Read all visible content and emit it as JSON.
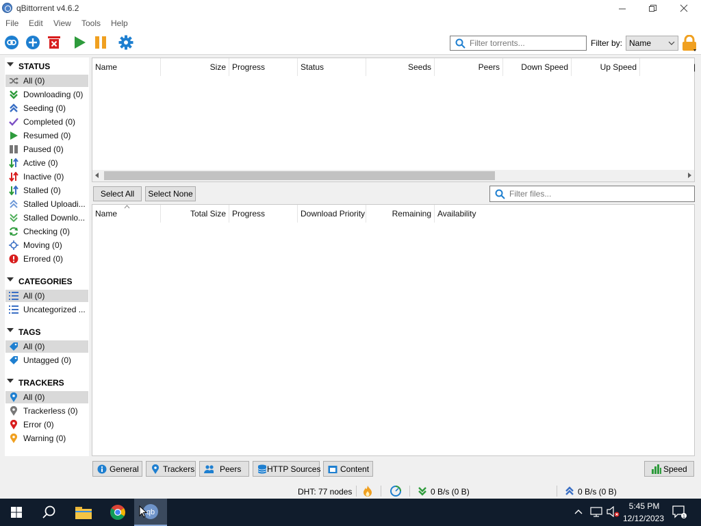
{
  "window": {
    "title": "qBittorrent v4.6.2"
  },
  "menu": [
    "File",
    "Edit",
    "View",
    "Tools",
    "Help"
  ],
  "toolbar": {
    "filter_placeholder": "Filter torrents...",
    "filter_by_label": "Filter by:",
    "filter_by_value": "Name"
  },
  "sidebar": {
    "status_header": "STATUS",
    "status": [
      {
        "label": "All (0)",
        "icon": "shuffle-icon"
      },
      {
        "label": "Downloading (0)",
        "icon": "download-icon"
      },
      {
        "label": "Seeding (0)",
        "icon": "upload-icon"
      },
      {
        "label": "Completed (0)",
        "icon": "check-icon"
      },
      {
        "label": "Resumed (0)",
        "icon": "play-icon"
      },
      {
        "label": "Paused (0)",
        "icon": "pause-icon"
      },
      {
        "label": "Active (0)",
        "icon": "active-arrows-icon"
      },
      {
        "label": "Inactive (0)",
        "icon": "inactive-arrows-icon"
      },
      {
        "label": "Stalled (0)",
        "icon": "stalled-arrows-icon"
      },
      {
        "label": "Stalled Uploadi...",
        "icon": "stalled-upload-icon"
      },
      {
        "label": "Stalled Downlo...",
        "icon": "stalled-download-icon"
      },
      {
        "label": "Checking (0)",
        "icon": "refresh-icon"
      },
      {
        "label": "Moving (0)",
        "icon": "crosshair-icon"
      },
      {
        "label": "Errored (0)",
        "icon": "error-icon"
      }
    ],
    "categories_header": "CATEGORIES",
    "categories": [
      {
        "label": "All (0)",
        "icon": "list-icon"
      },
      {
        "label": "Uncategorized ...",
        "icon": "list-icon"
      }
    ],
    "tags_header": "TAGS",
    "tags": [
      {
        "label": "All (0)",
        "icon": "tag-icon"
      },
      {
        "label": "Untagged (0)",
        "icon": "tag-icon"
      }
    ],
    "trackers_header": "TRACKERS",
    "trackers": [
      {
        "label": "All (0)",
        "icon": "pin-blue-icon"
      },
      {
        "label": "Trackerless (0)",
        "icon": "pin-gray-icon"
      },
      {
        "label": "Error (0)",
        "icon": "pin-red-icon"
      },
      {
        "label": "Warning (0)",
        "icon": "pin-orange-icon"
      }
    ]
  },
  "torrent_columns": [
    "Name",
    "Size",
    "Progress",
    "Status",
    "Seeds",
    "Peers",
    "Down Speed",
    "Up Speed"
  ],
  "file_pane": {
    "select_all": "Select All",
    "select_none": "Select None",
    "filter_placeholder": "Filter files...",
    "columns": [
      "Name",
      "Total Size",
      "Progress",
      "Download Priority",
      "Remaining",
      "Availability"
    ]
  },
  "tabs": [
    "General",
    "Trackers",
    "Peers",
    "HTTP Sources",
    "Content"
  ],
  "speed_button": "Speed",
  "statusbar": {
    "dht": "DHT: 77 nodes",
    "download": "0 B/s (0 B)",
    "upload": "0 B/s (0 B)"
  },
  "taskbar": {
    "time": "5:45 PM",
    "date": "12/12/2023"
  },
  "colors": {
    "accent_blue": "#1e7fd0",
    "green": "#2e9b3c",
    "red": "#d81e1e",
    "orange": "#f0a020",
    "taskbar": "#101c2c"
  }
}
